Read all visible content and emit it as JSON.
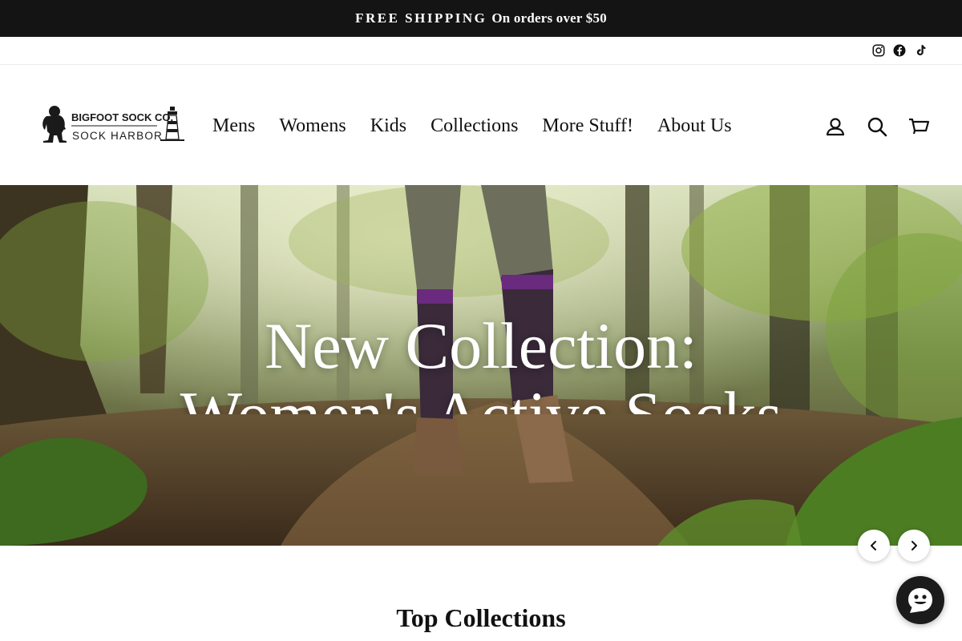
{
  "announcement": {
    "bold": "FREE SHIPPING",
    "rest": "On orders over $50"
  },
  "social": [
    {
      "name": "instagram-icon",
      "label": "Instagram"
    },
    {
      "name": "facebook-icon",
      "label": "Facebook"
    },
    {
      "name": "tiktok-icon",
      "label": "TikTok"
    }
  ],
  "logo": {
    "line1": "BIGFOOT SOCK CO.",
    "line2": "SOCK HARBOR"
  },
  "nav": {
    "mens": "Mens",
    "womens": "Womens",
    "kids": "Kids",
    "collections": "Collections",
    "more": "More Stuff!",
    "about": "About Us"
  },
  "header_icons": [
    "user-icon",
    "search-icon",
    "cart-icon"
  ],
  "hero": {
    "line1": "New Collection:",
    "line2": "Women's Active Socks"
  },
  "slider": {
    "prev_icon": "chevron-left-icon",
    "next_icon": "chevron-right-icon"
  },
  "section": {
    "title": "Top Collections"
  },
  "chat": {
    "icon": "chat-smiley-icon"
  },
  "colors": {
    "announcement_bg": "#141414",
    "accent_dark": "#1b1b1b",
    "text": "#111111"
  }
}
